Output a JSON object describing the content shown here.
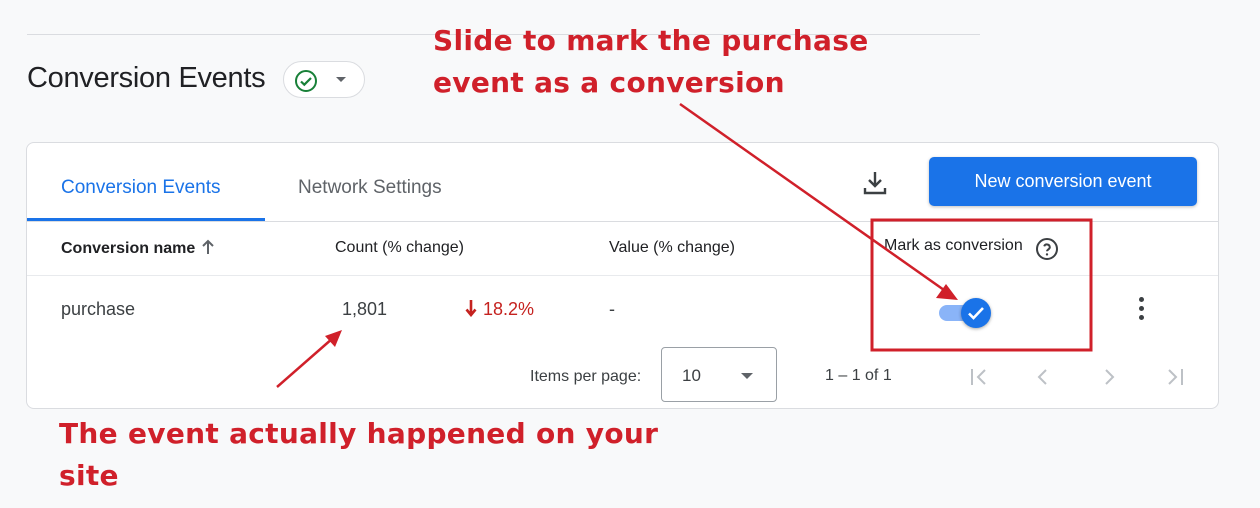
{
  "page": {
    "title": "Conversion Events"
  },
  "tabs": [
    {
      "label": "Conversion Events",
      "active": true
    },
    {
      "label": "Network Settings",
      "active": false
    }
  ],
  "toolbar": {
    "new_event_label": "New conversion event",
    "download_icon": "download-icon"
  },
  "table": {
    "headers": {
      "name": "Conversion name",
      "count": "Count (% change)",
      "value": "Value (% change)",
      "mark": "Mark as conversion"
    },
    "rows": [
      {
        "name": "purchase",
        "count": "1,801",
        "change": "18.2%",
        "change_direction": "down",
        "value": "-",
        "mark_as_conversion": true
      }
    ]
  },
  "pagination": {
    "items_per_page_label": "Items per page:",
    "items_per_page_value": "10",
    "range": "1 – 1 of 1"
  },
  "annotations": {
    "top_line1": "Slide to mark the purchase",
    "top_line2": "event as a conversion",
    "bottom_line1": "The event actually happened on your",
    "bottom_line2": "site"
  },
  "colors": {
    "primary": "#1a73e8",
    "negative_change": "#c5221f",
    "annotation": "#d0202a",
    "status_ok": "#188038"
  }
}
